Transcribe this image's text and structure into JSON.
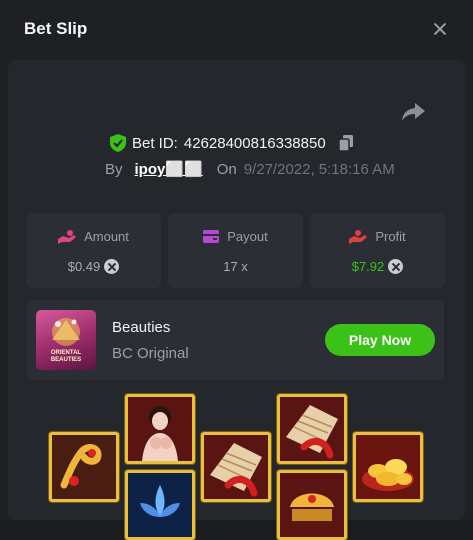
{
  "modal": {
    "title": "Bet Slip",
    "close_icon": "close-icon"
  },
  "bet": {
    "id_label": "Bet ID:",
    "id_value": "42628400816338850",
    "by_label": "By",
    "username": "ipoy⬜⬜",
    "on_label": "On",
    "datetime": "9/27/2022, 5:18:16 AM",
    "verified_icon": "shield-check-icon",
    "copy_icon": "copy-icon",
    "share_icon": "share-icon"
  },
  "stats": {
    "amount": {
      "label": "Amount",
      "value": "$0.49",
      "icon": "hand-coins-icon",
      "currency_icon": "coin-icon"
    },
    "payout": {
      "label": "Payout",
      "value": "17 x",
      "icon": "wallet-icon"
    },
    "profit": {
      "label": "Profit",
      "value": "$7.92",
      "icon": "hand-money-icon",
      "currency_icon": "coin-icon"
    }
  },
  "game": {
    "name": "Beauties",
    "provider": "BC Original",
    "thumb_text": "ORIENTAL BEAUTIES",
    "play_label": "Play Now"
  },
  "colors": {
    "accent_green": "#3bc117",
    "tile_border": "#e9bf3e",
    "amount_icon": "#e0457b",
    "payout_icon": "#b549d6",
    "profit_icon": "#e04040"
  },
  "reel_symbols": [
    "jade-ruyi-symbol",
    "lady-portrait-symbol",
    "folding-fan-koi-symbol",
    "folding-fan-koi-symbol",
    "gold-ingots-symbol",
    "blue-lotus-symbol",
    "golden-comb-symbol"
  ]
}
